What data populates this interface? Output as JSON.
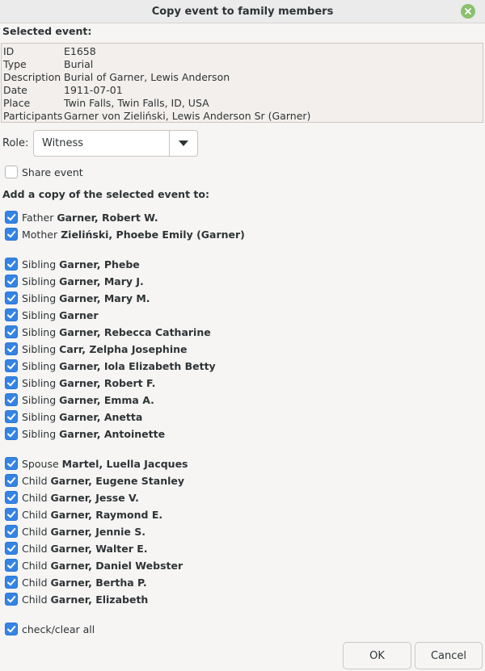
{
  "dialog": {
    "title": "Copy event to family members",
    "close_icon": "close-icon"
  },
  "selected_event": {
    "heading": "Selected event:",
    "rows": [
      {
        "key": "ID",
        "value": "E1658"
      },
      {
        "key": "Type",
        "value": "Burial"
      },
      {
        "key": "Description",
        "value": "Burial of Garner, Lewis Anderson"
      },
      {
        "key": "Date",
        "value": "1911-07-01"
      },
      {
        "key": "Place",
        "value": "Twin Falls, Twin Falls, ID, USA"
      },
      {
        "key": "Participants",
        "value": "Garner von Zieliński, Lewis Anderson Sr (Garner)"
      }
    ]
  },
  "role": {
    "label": "Role:",
    "value": "Witness",
    "arrow_icon": "dropdown-arrow-icon"
  },
  "share_event": {
    "label": "Share event",
    "checked": false
  },
  "add_copy_heading": "Add a copy of the selected event to:",
  "members": [
    {
      "relation": "Father",
      "name": "Garner, Robert W.",
      "checked": true
    },
    {
      "relation": "Mother",
      "name": "Zieliński, Phoebe Emily (Garner)",
      "checked": true
    },
    {
      "relation": "Sibling",
      "name": "Garner, Phebe",
      "checked": true
    },
    {
      "relation": "Sibling",
      "name": "Garner, Mary J.",
      "checked": true
    },
    {
      "relation": "Sibling",
      "name": "Garner, Mary M.",
      "checked": true
    },
    {
      "relation": "Sibling",
      "name": "Garner",
      "checked": true
    },
    {
      "relation": "Sibling",
      "name": "Garner, Rebecca Catharine",
      "checked": true
    },
    {
      "relation": "Sibling",
      "name": "Carr, Zelpha Josephine",
      "checked": true
    },
    {
      "relation": "Sibling",
      "name": "Garner, Iola Elizabeth Betty",
      "checked": true
    },
    {
      "relation": "Sibling",
      "name": "Garner, Robert F.",
      "checked": true
    },
    {
      "relation": "Sibling",
      "name": "Garner, Emma A.",
      "checked": true
    },
    {
      "relation": "Sibling",
      "name": "Garner, Anetta",
      "checked": true
    },
    {
      "relation": "Sibling",
      "name": "Garner, Antoinette",
      "checked": true
    },
    {
      "relation": "Spouse",
      "name": "Martel, Luella Jacques",
      "checked": true
    },
    {
      "relation": "Child",
      "name": "Garner, Eugene Stanley",
      "checked": true
    },
    {
      "relation": "Child",
      "name": "Garner, Jesse V.",
      "checked": true
    },
    {
      "relation": "Child",
      "name": "Garner, Raymond E.",
      "checked": true
    },
    {
      "relation": "Child",
      "name": "Garner, Jennie S.",
      "checked": true
    },
    {
      "relation": "Child",
      "name": "Garner, Walter E.",
      "checked": true
    },
    {
      "relation": "Child",
      "name": "Garner, Daniel Webster",
      "checked": true
    },
    {
      "relation": "Child",
      "name": "Garner, Bertha P.",
      "checked": true
    },
    {
      "relation": "Child",
      "name": "Garner, Elizabeth",
      "checked": true
    }
  ],
  "check_all": {
    "label": "check/clear all",
    "checked": true
  },
  "buttons": {
    "ok": "OK",
    "cancel": "Cancel"
  },
  "colors": {
    "accent": "#3584e4",
    "close": "#8ac06e"
  }
}
